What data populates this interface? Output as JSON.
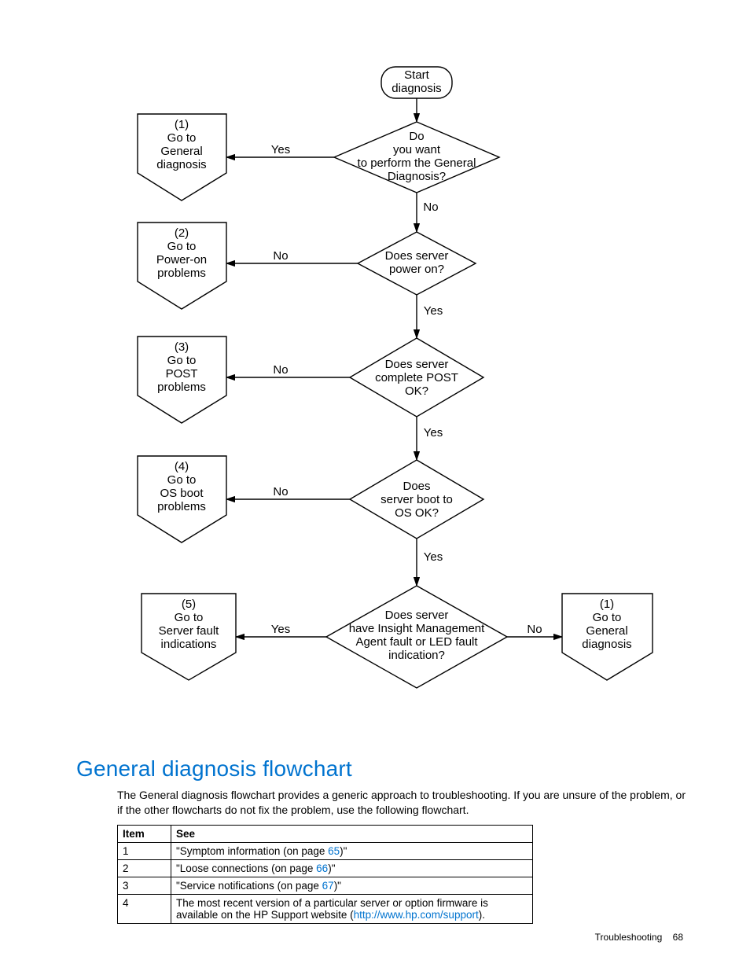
{
  "flowchart": {
    "start": "Start\ndiagnosis",
    "d1": "Do\nyou want\nto perform the General\nDiagnosis?",
    "d2": "Does server\npower on?",
    "d3": "Does server\ncomplete POST\nOK?",
    "d4": "Does\nserver boot to\nOS OK?",
    "d5": "Does server\nhave Insight Management\nAgent fault or LED fault\nindication?",
    "r1": "(1)\nGo to\nGeneral\ndiagnosis",
    "r2": "(2)\nGo to\nPower-on\nproblems",
    "r3": "(3)\nGo to\nPOST\nproblems",
    "r4": "(4)\nGo to\nOS boot\nproblems",
    "r5": "(5)\nGo to\nServer fault\nindications",
    "r6": "(1)\nGo to\nGeneral\ndiagnosis",
    "yes": "Yes",
    "no": "No"
  },
  "heading": "General diagnosis flowchart",
  "paragraph": "The General diagnosis flowchart provides a generic approach to troubleshooting. If you are unsure of the problem, or if the other flowcharts do not fix the problem, use the following flowchart.",
  "table": {
    "headers": [
      "Item",
      "See"
    ],
    "rows": [
      {
        "item": "1",
        "pre": "\"Symptom information (on page ",
        "link": "65",
        "post": ")\""
      },
      {
        "item": "2",
        "pre": "\"Loose connections (on page ",
        "link": "66",
        "post": ")\""
      },
      {
        "item": "3",
        "pre": "\"Service notifications (on page ",
        "link": "67",
        "post": ")\""
      },
      {
        "item": "4",
        "pre": "The most recent version of a particular server or option firmware is available on the HP Support website (",
        "link": "http://www.hp.com/support",
        "post": ")."
      }
    ]
  },
  "footer": {
    "section": "Troubleshooting",
    "page": "68"
  }
}
